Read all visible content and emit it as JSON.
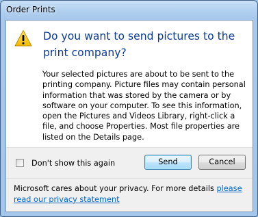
{
  "window": {
    "title": "Order Prints"
  },
  "dialog": {
    "icon": "warning-icon",
    "heading": "Do you want to send pictures to the print company?",
    "body": "Your selected pictures are about to be sent to the printing company. Picture files may contain personal information that was stored by the camera or by software on your computer. To see this information, open the Pictures and Videos Library, right-click a file, and choose Properties. Most file properties are listed on the Details page."
  },
  "options": {
    "dont_show_label": "Don't show this again",
    "dont_show_checked": false
  },
  "buttons": {
    "send": "Send",
    "cancel": "Cancel"
  },
  "footer": {
    "text": "Microsoft cares about your privacy. For more details ",
    "link": "please read our privacy statement"
  },
  "colors": {
    "heading": "#0a3a94",
    "link": "#0066cc",
    "frame": "#a4c6ea",
    "warning": "#f7c600"
  }
}
